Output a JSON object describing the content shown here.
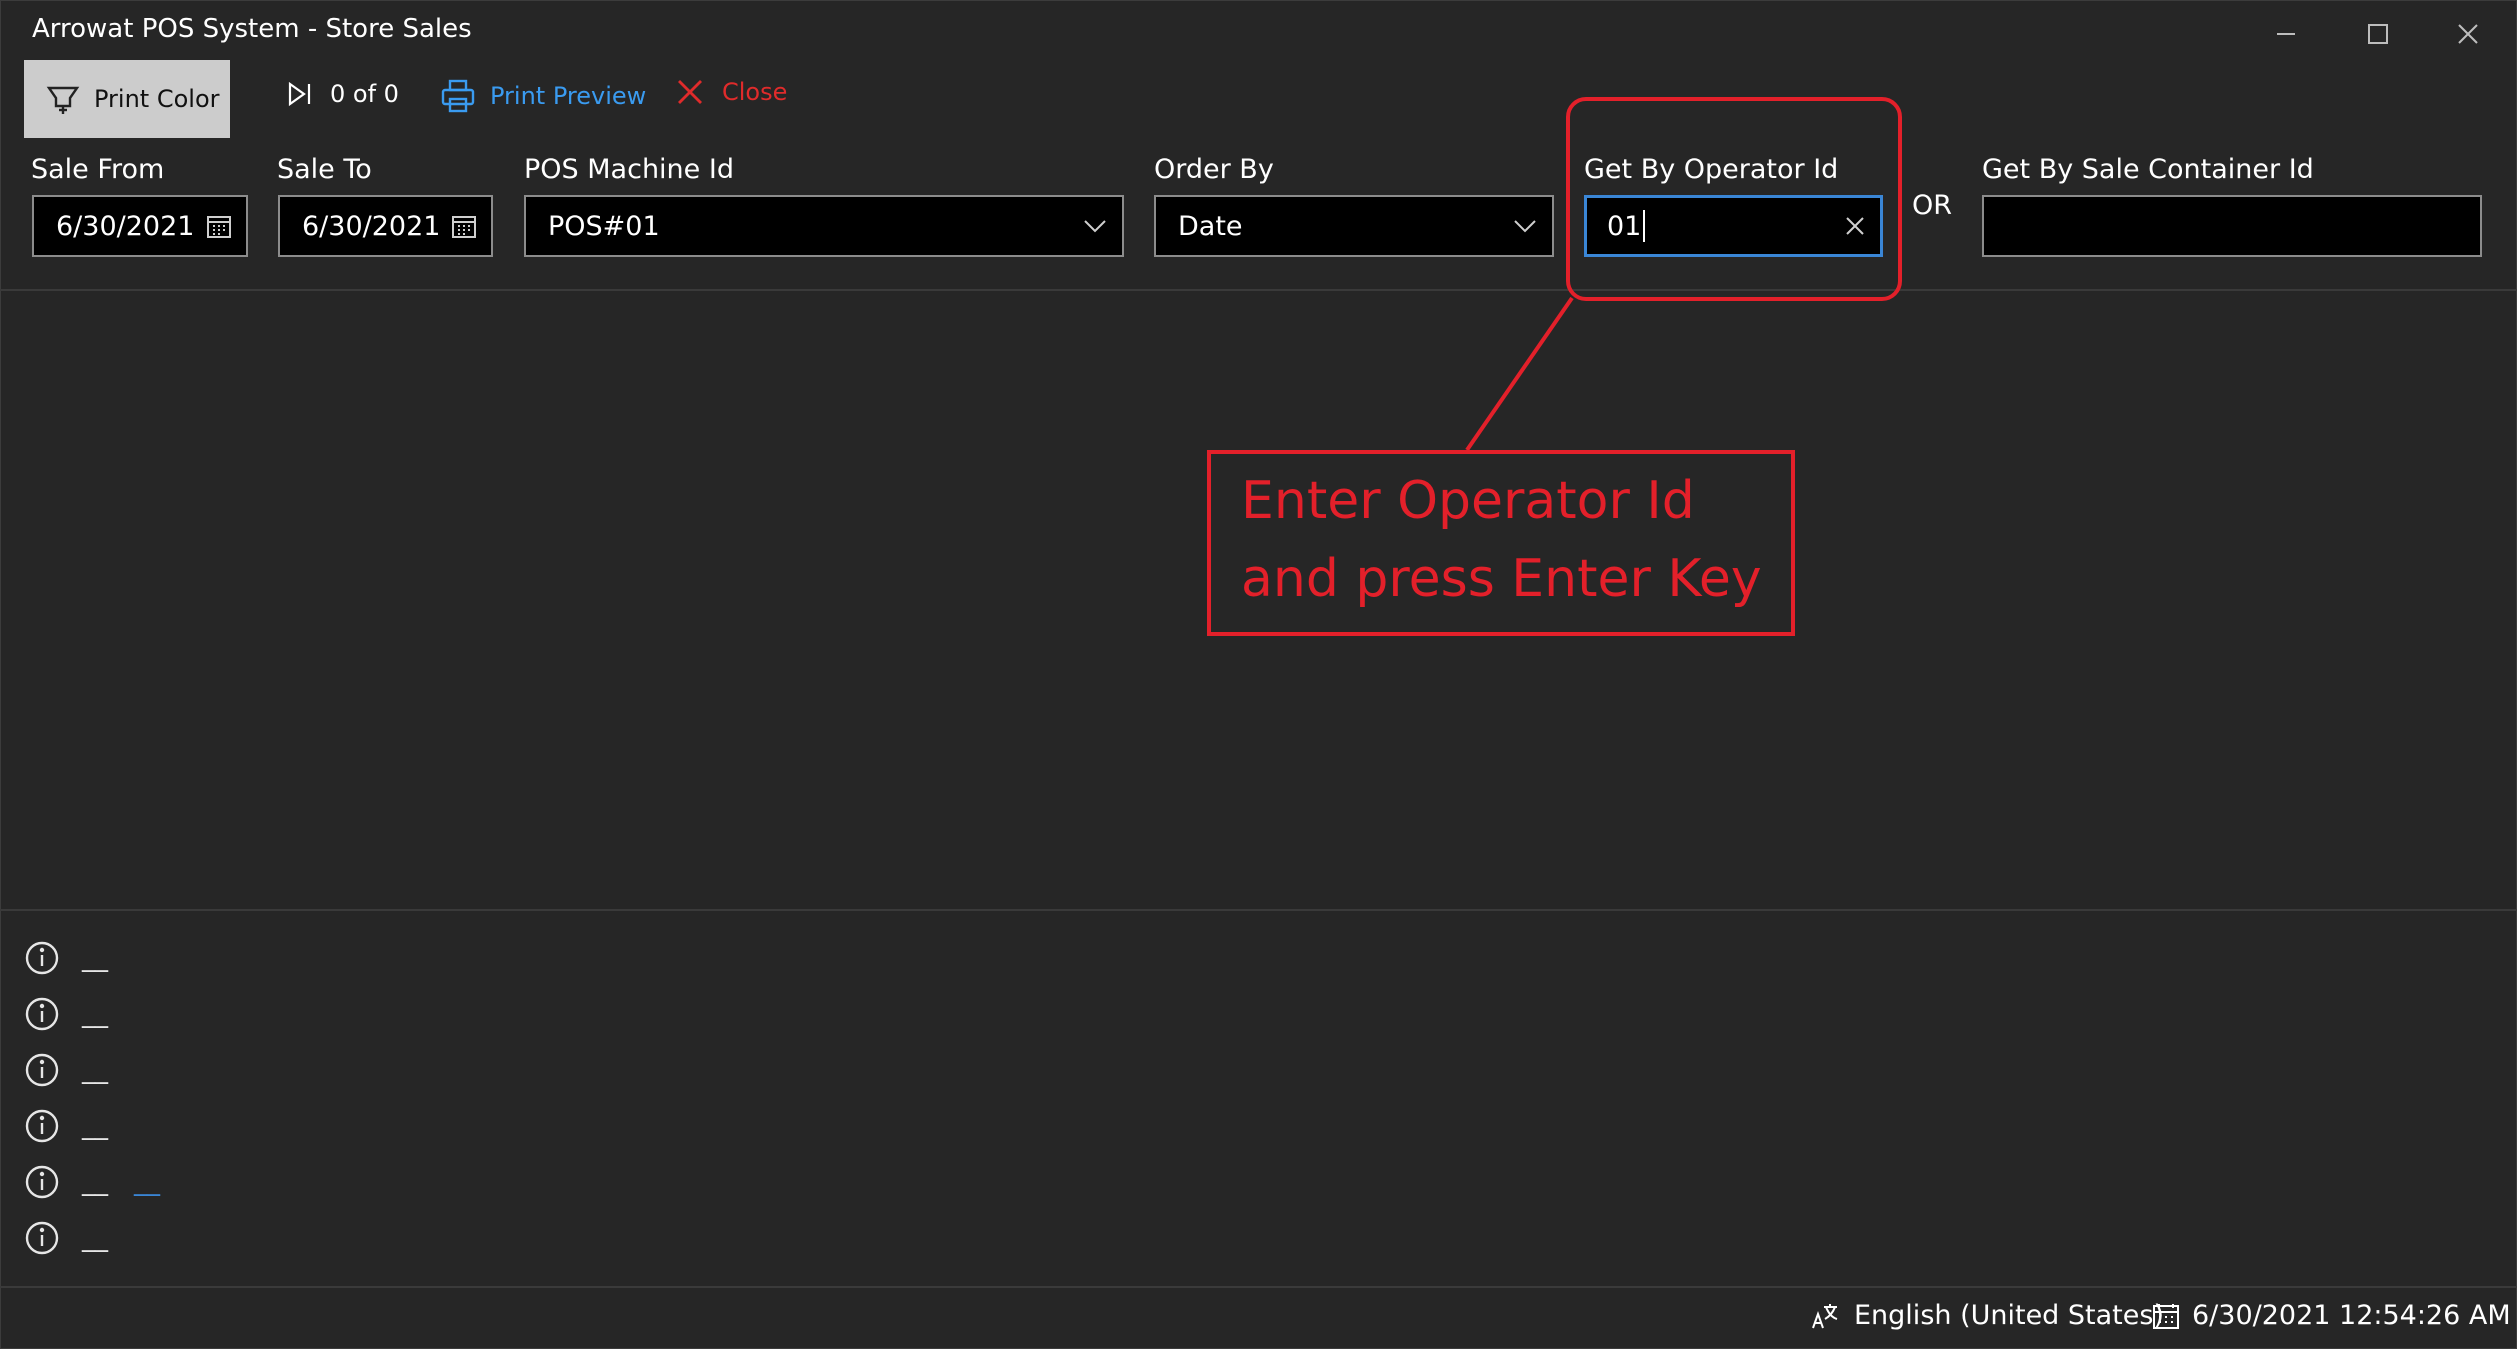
{
  "window": {
    "title": "Arrowat POS System - Store Sales"
  },
  "toolbar": {
    "print_color_label": "Print Color",
    "record_counter": "0 of 0",
    "print_preview_label": "Print Preview",
    "close_label": "Close"
  },
  "filters": {
    "sale_from": {
      "label": "Sale From",
      "value": "6/30/2021"
    },
    "sale_to": {
      "label": "Sale To",
      "value": "6/30/2021"
    },
    "pos_machine": {
      "label": "POS Machine Id",
      "value": "POS#01"
    },
    "order_by": {
      "label": "Order By",
      "value": "Date"
    },
    "operator_id": {
      "label": "Get By Operator Id",
      "value": "01"
    },
    "or_text": "OR",
    "sale_container_id": {
      "label": "Get By Sale Container Id",
      "value": ""
    }
  },
  "annotation": {
    "line1": "Enter Operator Id",
    "line2": "and press Enter Key"
  },
  "info_rows": [
    {
      "text": "__"
    },
    {
      "text": "__"
    },
    {
      "text": "__"
    },
    {
      "text": "__"
    },
    {
      "text": "__",
      "link": "__"
    },
    {
      "text": "__"
    }
  ],
  "status_bar": {
    "language": "English (United States)",
    "datetime": "6/30/2021 12:54:26 AM"
  },
  "colors": {
    "background": "#262626",
    "accent_blue": "#3a9bf0",
    "close_red": "#e02b2b",
    "annotation_red": "#e3202a"
  }
}
